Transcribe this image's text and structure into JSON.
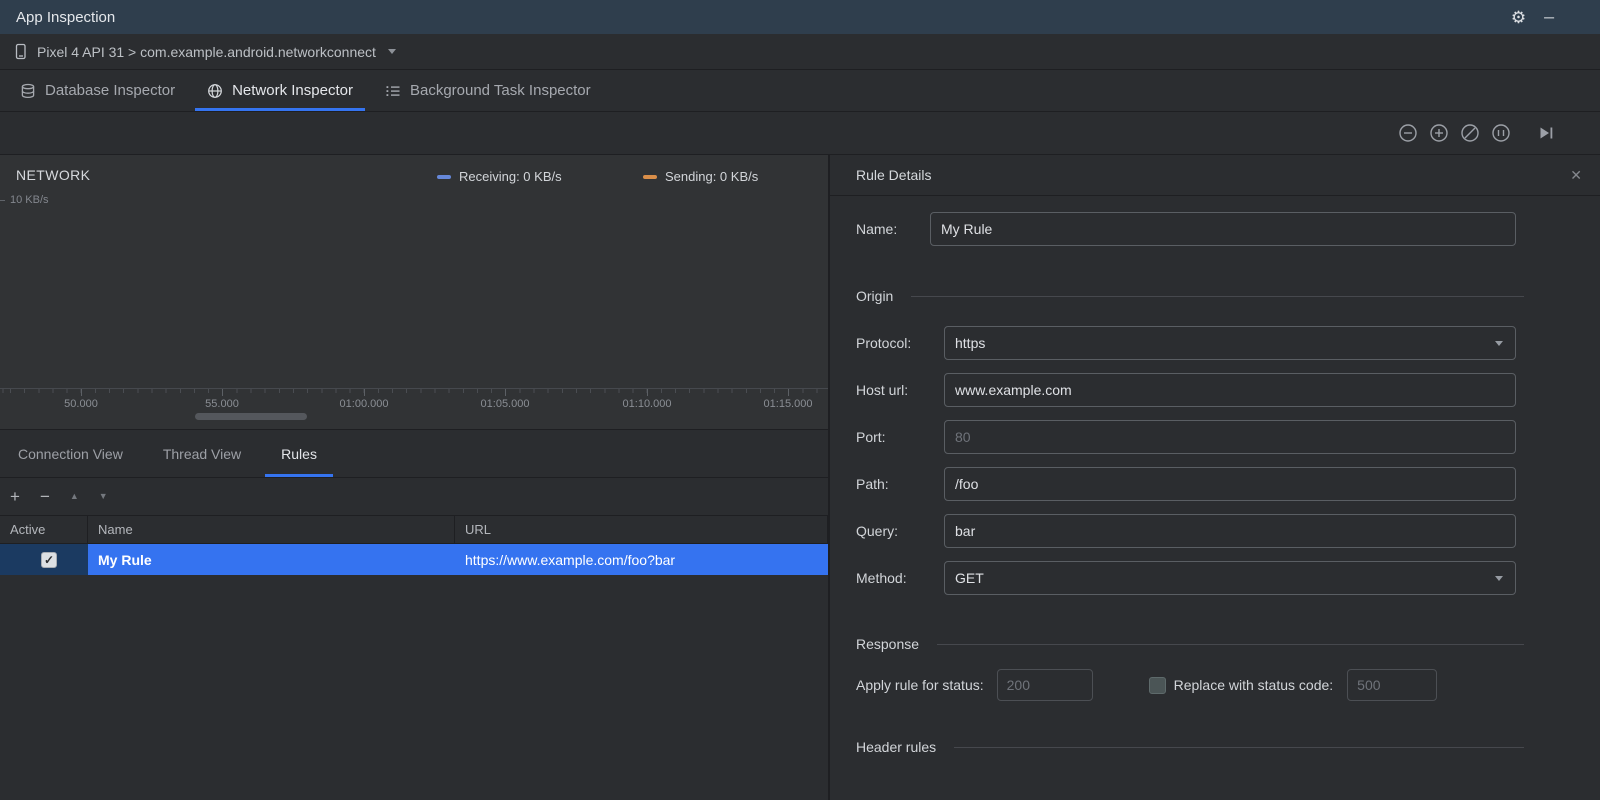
{
  "titlebar": {
    "title": "App Inspection"
  },
  "device_bar": {
    "selector": "Pixel 4 API 31 > com.example.android.networkconnect"
  },
  "inspector_tabs": [
    {
      "label": "Database Inspector"
    },
    {
      "label": "Network Inspector"
    },
    {
      "label": "Background Task Inspector"
    }
  ],
  "timeline": {
    "title": "NETWORK",
    "y_axis_label": "10 KB/s",
    "legend": [
      {
        "label": "Receiving: 0 KB/s",
        "color": "#6688d9"
      },
      {
        "label": "Sending: 0 KB/s",
        "color": "#d98e49"
      }
    ],
    "ticks": [
      "50.000",
      "55.000",
      "01:00.000",
      "01:05.000",
      "01:10.000",
      "01:15.000"
    ]
  },
  "view_tabs": [
    {
      "label": "Connection View"
    },
    {
      "label": "Thread View"
    },
    {
      "label": "Rules"
    }
  ],
  "rules_table": {
    "columns": [
      "Active",
      "Name",
      "URL"
    ],
    "row": {
      "active": true,
      "name": "My Rule",
      "url": "https://www.example.com/foo?bar"
    }
  },
  "rule_details": {
    "title": "Rule Details",
    "name_label": "Name:",
    "name_value": "My Rule",
    "sections": {
      "origin": "Origin",
      "response": "Response",
      "header_rules": "Header rules"
    },
    "origin": {
      "protocol_label": "Protocol:",
      "protocol_value": "https",
      "host_label": "Host url:",
      "host_value": "www.example.com",
      "port_label": "Port:",
      "port_placeholder": "80",
      "path_label": "Path:",
      "path_value": "/foo",
      "query_label": "Query:",
      "query_value": "bar",
      "method_label": "Method:",
      "method_value": "GET"
    },
    "response": {
      "apply_label": "Apply rule for status:",
      "apply_placeholder": "200",
      "replace_label": "Replace with status code:",
      "replace_placeholder": "500",
      "replace_checked": false
    }
  },
  "glyphs": {
    "gear": "⚙",
    "minimize": "─",
    "close": "✕",
    "add": "+",
    "remove": "−",
    "up": "▲",
    "down": "▼",
    "check": "✓"
  },
  "colors": {
    "accent": "#3574f0",
    "selection": "#3573f0",
    "receiving": "#6688d9",
    "sending": "#d98e49"
  }
}
